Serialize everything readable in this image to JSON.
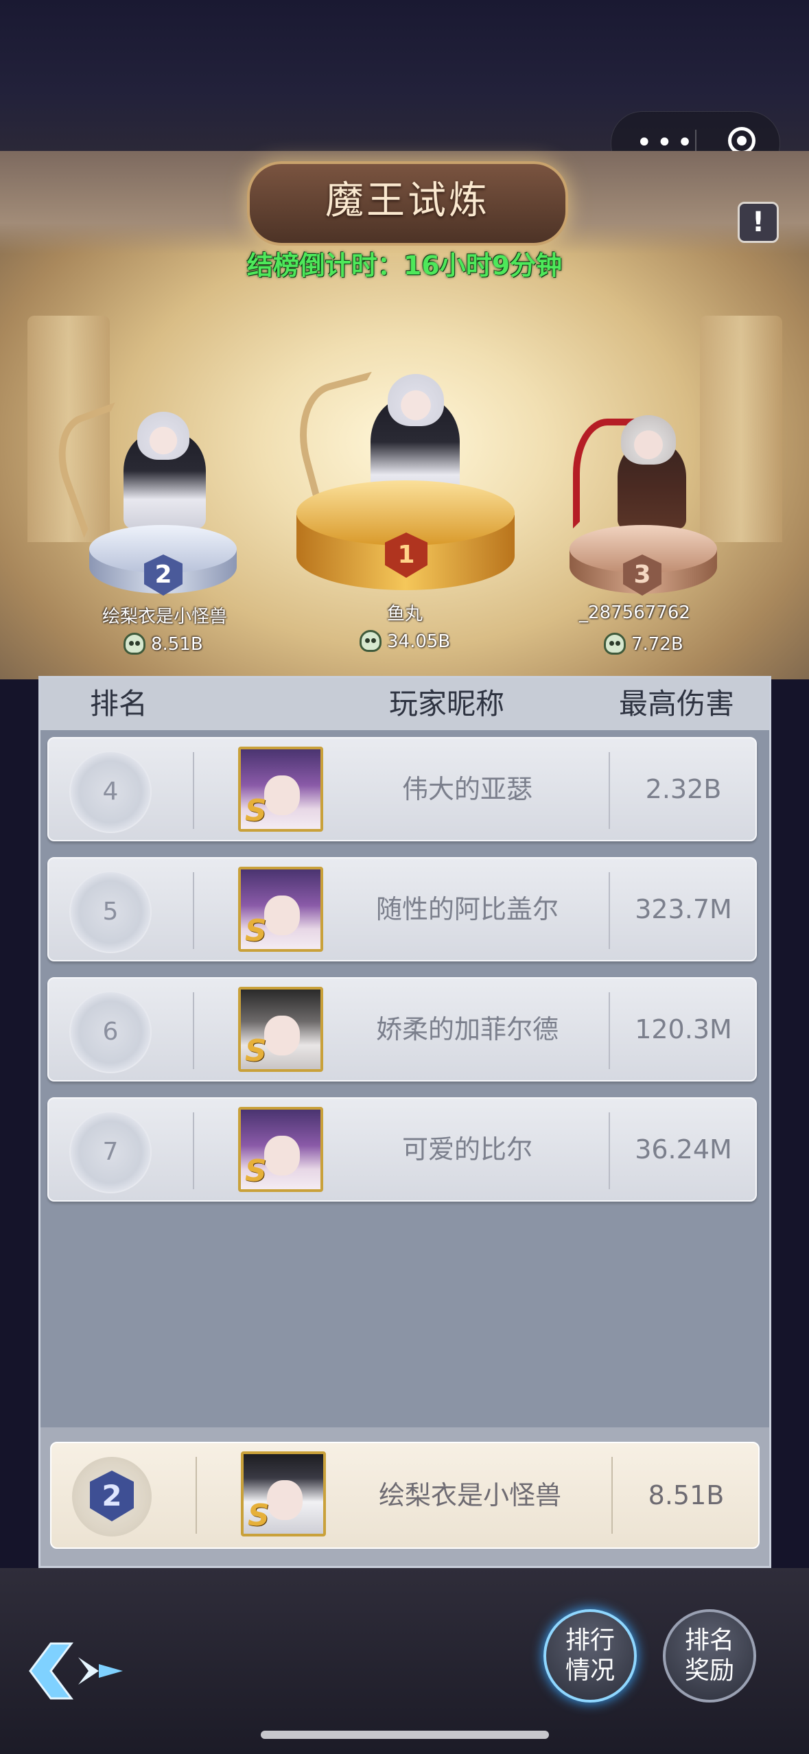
{
  "header": {
    "title": "魔王试炼",
    "countdown": "结榜倒计时：16小时9分钟",
    "help_icon": "exclamation-icon",
    "menu_dots": "•••"
  },
  "podium": [
    {
      "rank": "2",
      "name": "绘梨衣是小怪兽",
      "score": "8.51B"
    },
    {
      "rank": "1",
      "name": "鱼丸",
      "score": "34.05B"
    },
    {
      "rank": "3",
      "name": "_287567762",
      "score": "7.72B"
    }
  ],
  "table": {
    "headers": {
      "rank": "排名",
      "name": "玩家昵称",
      "damage": "最高伤害"
    },
    "rows": [
      {
        "rank": "4",
        "name": "伟大的亚瑟",
        "damage": "2.32B"
      },
      {
        "rank": "5",
        "name": "随性的阿比盖尔",
        "damage": "323.7M"
      },
      {
        "rank": "6",
        "name": "娇柔的加菲尔德",
        "damage": "120.3M"
      },
      {
        "rank": "7",
        "name": "可爱的比尔",
        "damage": "36.24M"
      }
    ],
    "self": {
      "rank": "2",
      "name": "绘梨衣是小怪兽",
      "damage": "8.51B"
    }
  },
  "avatar_grade": "S",
  "buttons": {
    "ranking": "排行\n情况",
    "reward": "排名\n奖励"
  }
}
